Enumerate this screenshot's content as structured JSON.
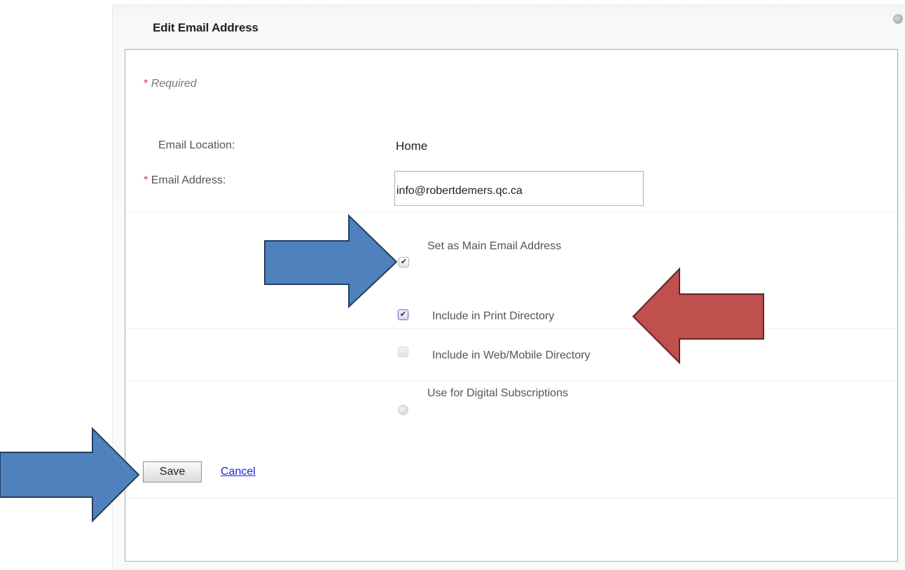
{
  "dialog": {
    "title": "Edit Email Address",
    "required_note": "Required",
    "required_marker": "*"
  },
  "form": {
    "email_location_label": "Email Location:",
    "email_location_value": "Home",
    "email_address_label": "Email Address:",
    "email_address_value": "info@robertdemers.qc.ca"
  },
  "options": [
    {
      "label": "Set as Main Email Address",
      "checked": true,
      "control": "checkbox"
    },
    {
      "label": "Include in Print Directory",
      "checked": true,
      "control": "checkbox"
    },
    {
      "label": "Include in Web/Mobile Directory",
      "checked": false,
      "control": "checkbox",
      "disabled": true
    },
    {
      "label": "Use for Digital Subscriptions",
      "checked": false,
      "control": "radio",
      "disabled": true
    }
  ],
  "actions": {
    "save_label": "Save",
    "cancel_label": "Cancel"
  },
  "icons": {
    "checkmark": "✔"
  },
  "colors": {
    "blue_arrow_fill": "#4f81bd",
    "blue_arrow_stroke": "#243f60",
    "red_arrow_fill": "#c0504d",
    "red_arrow_stroke": "#632523",
    "required_star": "#e03030",
    "link": "#2222cc"
  }
}
